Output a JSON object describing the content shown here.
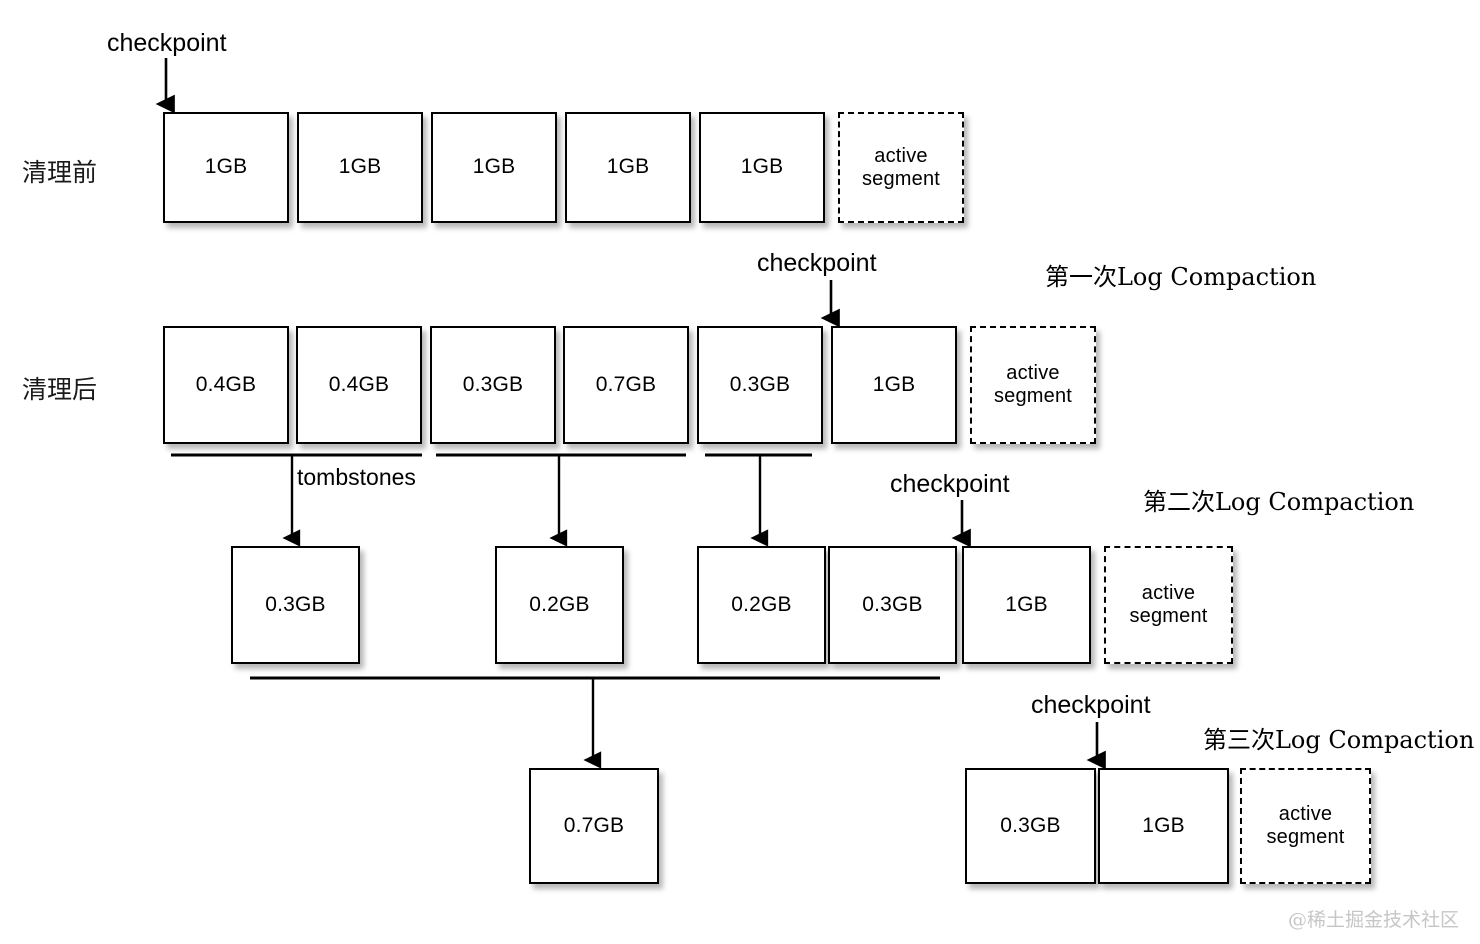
{
  "diagram": {
    "title_watermark": "@稀土掘金技术社区",
    "labels": {
      "before_cleanup": "清理前",
      "after_cleanup": "清理后",
      "checkpoint": "checkpoint",
      "tombstones": "tombstones",
      "compaction_1": "第一次Log Compaction",
      "compaction_2": "第二次Log Compaction",
      "compaction_3": "第三次Log Compaction",
      "active_segment_line1": "active",
      "active_segment_line2": "segment"
    },
    "rows": [
      {
        "name": "before-cleanup",
        "row_label": "清理前",
        "segments": [
          {
            "label": "1GB"
          },
          {
            "label": "1GB"
          },
          {
            "label": "1GB"
          },
          {
            "label": "1GB"
          },
          {
            "label": "1GB"
          }
        ],
        "active_segment": "active segment",
        "checkpoint_label": "checkpoint"
      },
      {
        "name": "after-cleanup",
        "row_label": "清理后",
        "segments": [
          {
            "label": "0.4GB"
          },
          {
            "label": "0.4GB"
          },
          {
            "label": "0.3GB"
          },
          {
            "label": "0.7GB"
          },
          {
            "label": "0.3GB"
          },
          {
            "label": "1GB"
          }
        ],
        "active_segment": "active segment",
        "checkpoint_label": "checkpoint",
        "compaction_label": "第一次Log Compaction",
        "group_label": "tombstones"
      },
      {
        "name": "second-compaction",
        "segments": [
          {
            "label": "0.3GB"
          },
          {
            "label": "0.2GB"
          },
          {
            "label": "0.2GB"
          },
          {
            "label": "0.3GB"
          },
          {
            "label": "1GB"
          }
        ],
        "active_segment": "active segment",
        "checkpoint_label": "checkpoint",
        "compaction_label": "第二次Log Compaction"
      },
      {
        "name": "third-compaction",
        "segments_left": [
          {
            "label": "0.7GB"
          }
        ],
        "segments_right": [
          {
            "label": "0.3GB"
          },
          {
            "label": "1GB"
          }
        ],
        "active_segment": "active segment",
        "checkpoint_label": "checkpoint",
        "compaction_label": "第三次Log Compaction"
      }
    ],
    "colors": {
      "stroke": "#000000",
      "background": "#ffffff",
      "watermark": "#c6c6c6"
    }
  }
}
